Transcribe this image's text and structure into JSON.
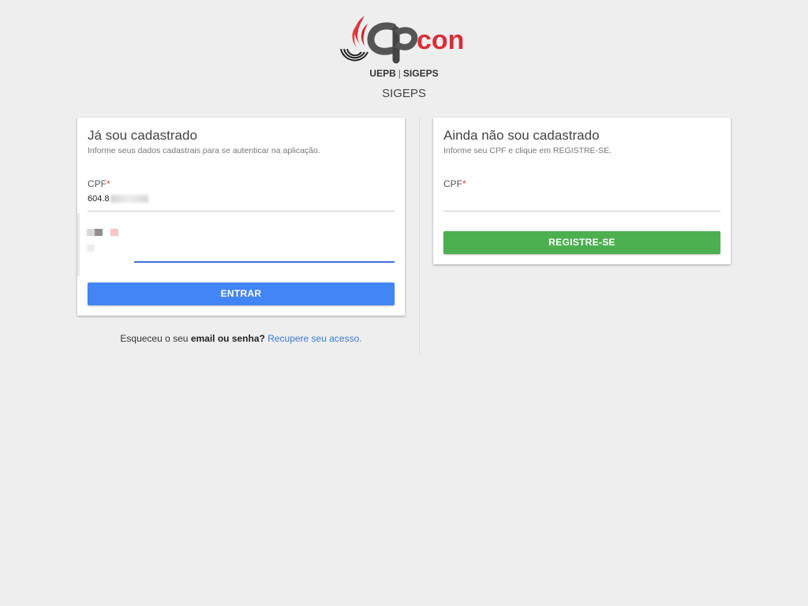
{
  "header": {
    "logo_text": "Cpcon",
    "org": "UEPB",
    "separator": "|",
    "system": "SIGEPS",
    "title": "SIGEPS"
  },
  "login_card": {
    "title": "Já sou cadastrado",
    "subtitle": "Informe seus dados cadastrais para se autenticar na aplicação.",
    "cpf_label": "CPF",
    "required_mark": "*",
    "cpf_value": "604.8",
    "password_value": "",
    "submit_label": "ENTRAR"
  },
  "register_card": {
    "title": "Ainda não sou cadastrado",
    "subtitle": "Informe seu CPF e clique em REGISTRE-SE.",
    "cpf_label": "CPF",
    "required_mark": "*",
    "cpf_value": "",
    "submit_label": "REGISTRE-SE"
  },
  "forgot": {
    "prefix": "Esqueceu o seu ",
    "bold": "email ou senha?",
    "link": "Recupere seu acesso."
  },
  "colors": {
    "primary_button": "#4285f4",
    "register_button": "#4caf50",
    "link": "#3a7bd5",
    "required": "#e53935",
    "brand_red": "#d62f3a"
  }
}
